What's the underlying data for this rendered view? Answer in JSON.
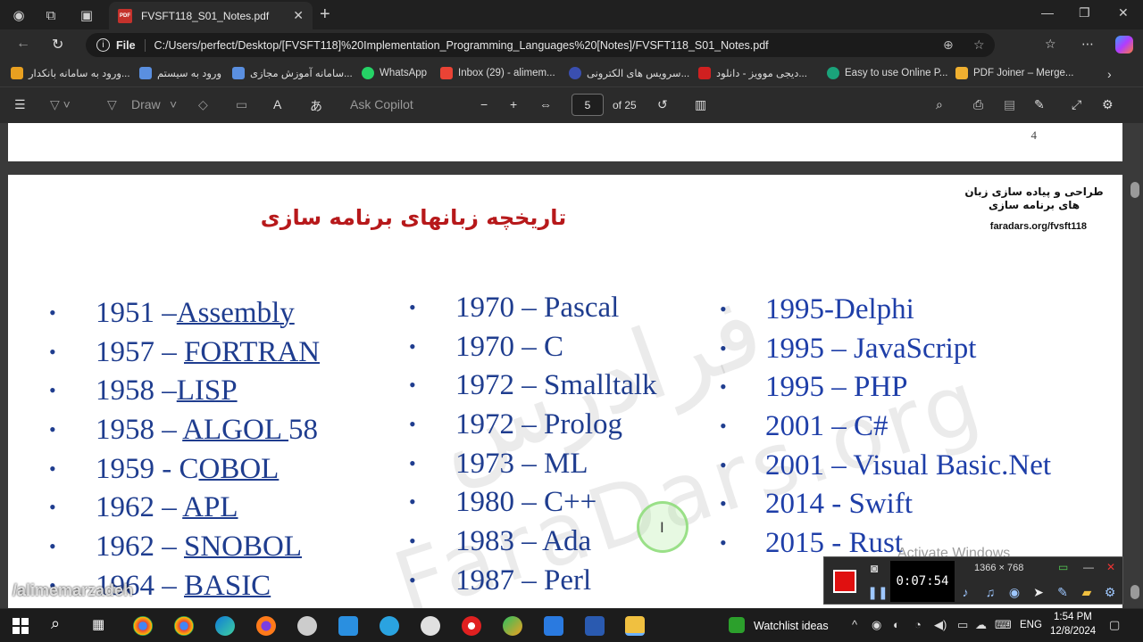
{
  "browser": {
    "tab_title": "FVSFT118_S01_Notes.pdf",
    "tab_close": "✕",
    "new_tab": "+",
    "file_label": "File",
    "url": "C:/Users/perfect/Desktop/[FVSFT118]%20Implementation_Programming_Languages%20[Notes]/FVSFT118_S01_Notes.pdf",
    "bookmarks": [
      {
        "label": "ورود به سامانه بانکدار...",
        "color": "#e8a020"
      },
      {
        "label": "ورود به سیستم",
        "color": "#5a8fe0"
      },
      {
        "label": "سامانه آموزش مجازی...",
        "color": "#5a8fe0"
      },
      {
        "label": "WhatsApp",
        "color": "#25d366"
      },
      {
        "label": "Inbox (29) - alimem...",
        "color": "#ea4335"
      },
      {
        "label": "سرویس های الکترونی...",
        "color": "#3a4fb0"
      },
      {
        "label": "دیجی موویز - دانلود...",
        "color": "#d02020"
      },
      {
        "label": "Easy to use Online P...",
        "color": "#1aa37a"
      },
      {
        "label": "PDF Joiner – Merge...",
        "color": "#f0b030"
      }
    ]
  },
  "pdf_toolbar": {
    "draw_label": "Draw",
    "ask_copilot": "Ask Copilot",
    "page_current": "5",
    "page_total": "of 25"
  },
  "document": {
    "prev_page_number": "4",
    "header_fa": "طراحی و پیاده سازی زبان های برنامه سازی",
    "header_url": "faradars.org/fvsft118",
    "slide_title": "تاریخچه زبانهای برنامه سازی",
    "bullet": "•",
    "columns": [
      [
        {
          "pre": "1951  –",
          "link": "Assembly",
          "post": ""
        },
        {
          "pre": "1957  –  ",
          "link": "FORTRAN",
          "post": ""
        },
        {
          "pre": "1958  –",
          "link": "LISP",
          "post": ""
        },
        {
          "pre": "1958 – ",
          "link": "ALGOL ",
          "post": "58"
        },
        {
          "pre": "1959  - C",
          "link": "OBOL",
          "post": ""
        },
        {
          "pre": "1962 – ",
          "link": "APL",
          "post": ""
        },
        {
          "pre": "1962 – ",
          "link": "SNOBOL",
          "post": ""
        },
        {
          "pre": "1964 – ",
          "link": "BASIC",
          "post": ""
        }
      ],
      [
        "1970 – Pascal",
        "1970 – C",
        "1972 – Smalltalk",
        "1972 – Prolog",
        "1973 – ML",
        "1980 – C++",
        "1983 – Ada",
        "1987 – Perl"
      ],
      [
        "1995-Delphi",
        "1995 – JavaScript",
        "1995 – PHP",
        "2001 – C#",
        "2001 – Visual Basic.Net",
        "2014 - Swift",
        "2015 - Rust"
      ]
    ],
    "activate_text": "Activate Windows"
  },
  "recorder": {
    "timer": "0:07:54",
    "resolution": "1366 × 768"
  },
  "overlay_user": "/alimemarzadeh",
  "taskbar": {
    "watchlist": "Watchlist ideas",
    "lang": "ENG",
    "time": "1:54 PM",
    "date": "12/8/2024"
  }
}
